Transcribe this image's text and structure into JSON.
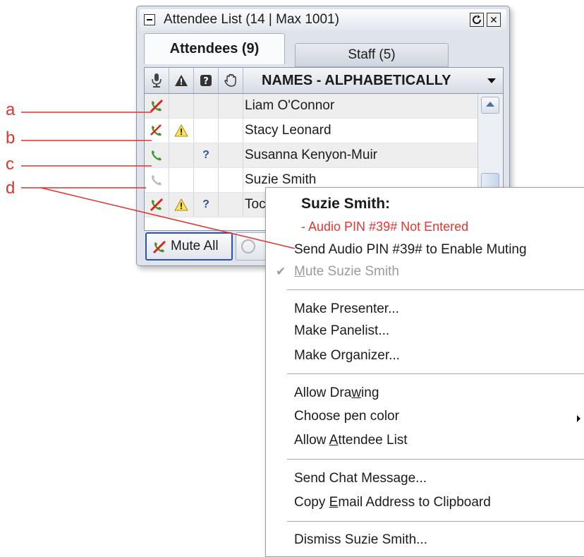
{
  "window": {
    "title": "Attendee List  (14 | Max 1001)",
    "restore_icon": "restore-icon",
    "close_icon": "close-icon"
  },
  "tabs": [
    {
      "label": "Attendees (9)",
      "active": true
    },
    {
      "label": "Staff (5)",
      "active": false
    }
  ],
  "grid": {
    "header_icons": [
      "microphone-icon",
      "warning-icon",
      "question-icon",
      "raised-hand-icon"
    ],
    "sort_label": "NAMES - ALPHABETICALLY",
    "rows": [
      {
        "name": "Liam O'Connor",
        "audio": "muted-phone",
        "warning": false,
        "question": false
      },
      {
        "name": "Stacy Leonard",
        "audio": "muted-phone-partial",
        "warning": true,
        "question": false
      },
      {
        "name": "Susanna Kenyon-Muir",
        "audio": "phone-active",
        "warning": false,
        "question": true
      },
      {
        "name": "Suzie Smith",
        "audio": "phone-inactive",
        "warning": false,
        "question": false
      },
      {
        "name": "Toc",
        "audio": "muted-phone",
        "warning": true,
        "question": true
      }
    ]
  },
  "footer": {
    "mute_all_label": "Mute All"
  },
  "annotations": [
    "a",
    "b",
    "c",
    "d"
  ],
  "context_menu": {
    "heading": "Suzie Smith:",
    "warning": "- Audio PIN #39# Not Entered",
    "items": [
      {
        "label": "Send Audio PIN #39# to Enable Muting"
      },
      {
        "label_pre": "",
        "label_u": "M",
        "label_post": "ute Suzie Smith",
        "disabled": true,
        "checked": true
      },
      {
        "label": "Make Presenter..."
      },
      {
        "label": "Make Panelist..."
      },
      {
        "label": "Make Organizer..."
      },
      {
        "label_pre": "Allow Dra",
        "label_u": "w",
        "label_post": "ing"
      },
      {
        "label": "Choose pen color",
        "submenu": true
      },
      {
        "label_pre": "Allow ",
        "label_u": "A",
        "label_post": "ttendee List"
      },
      {
        "label": "Send Chat Message..."
      },
      {
        "label_pre": "Copy ",
        "label_u": "E",
        "label_post": "mail Address to Clipboard"
      },
      {
        "label": "Dismiss Suzie Smith..."
      }
    ]
  },
  "colors": {
    "annotation": "#e0322f",
    "warning_text": "#e6362f",
    "mute_all_border": "#3050b0"
  }
}
